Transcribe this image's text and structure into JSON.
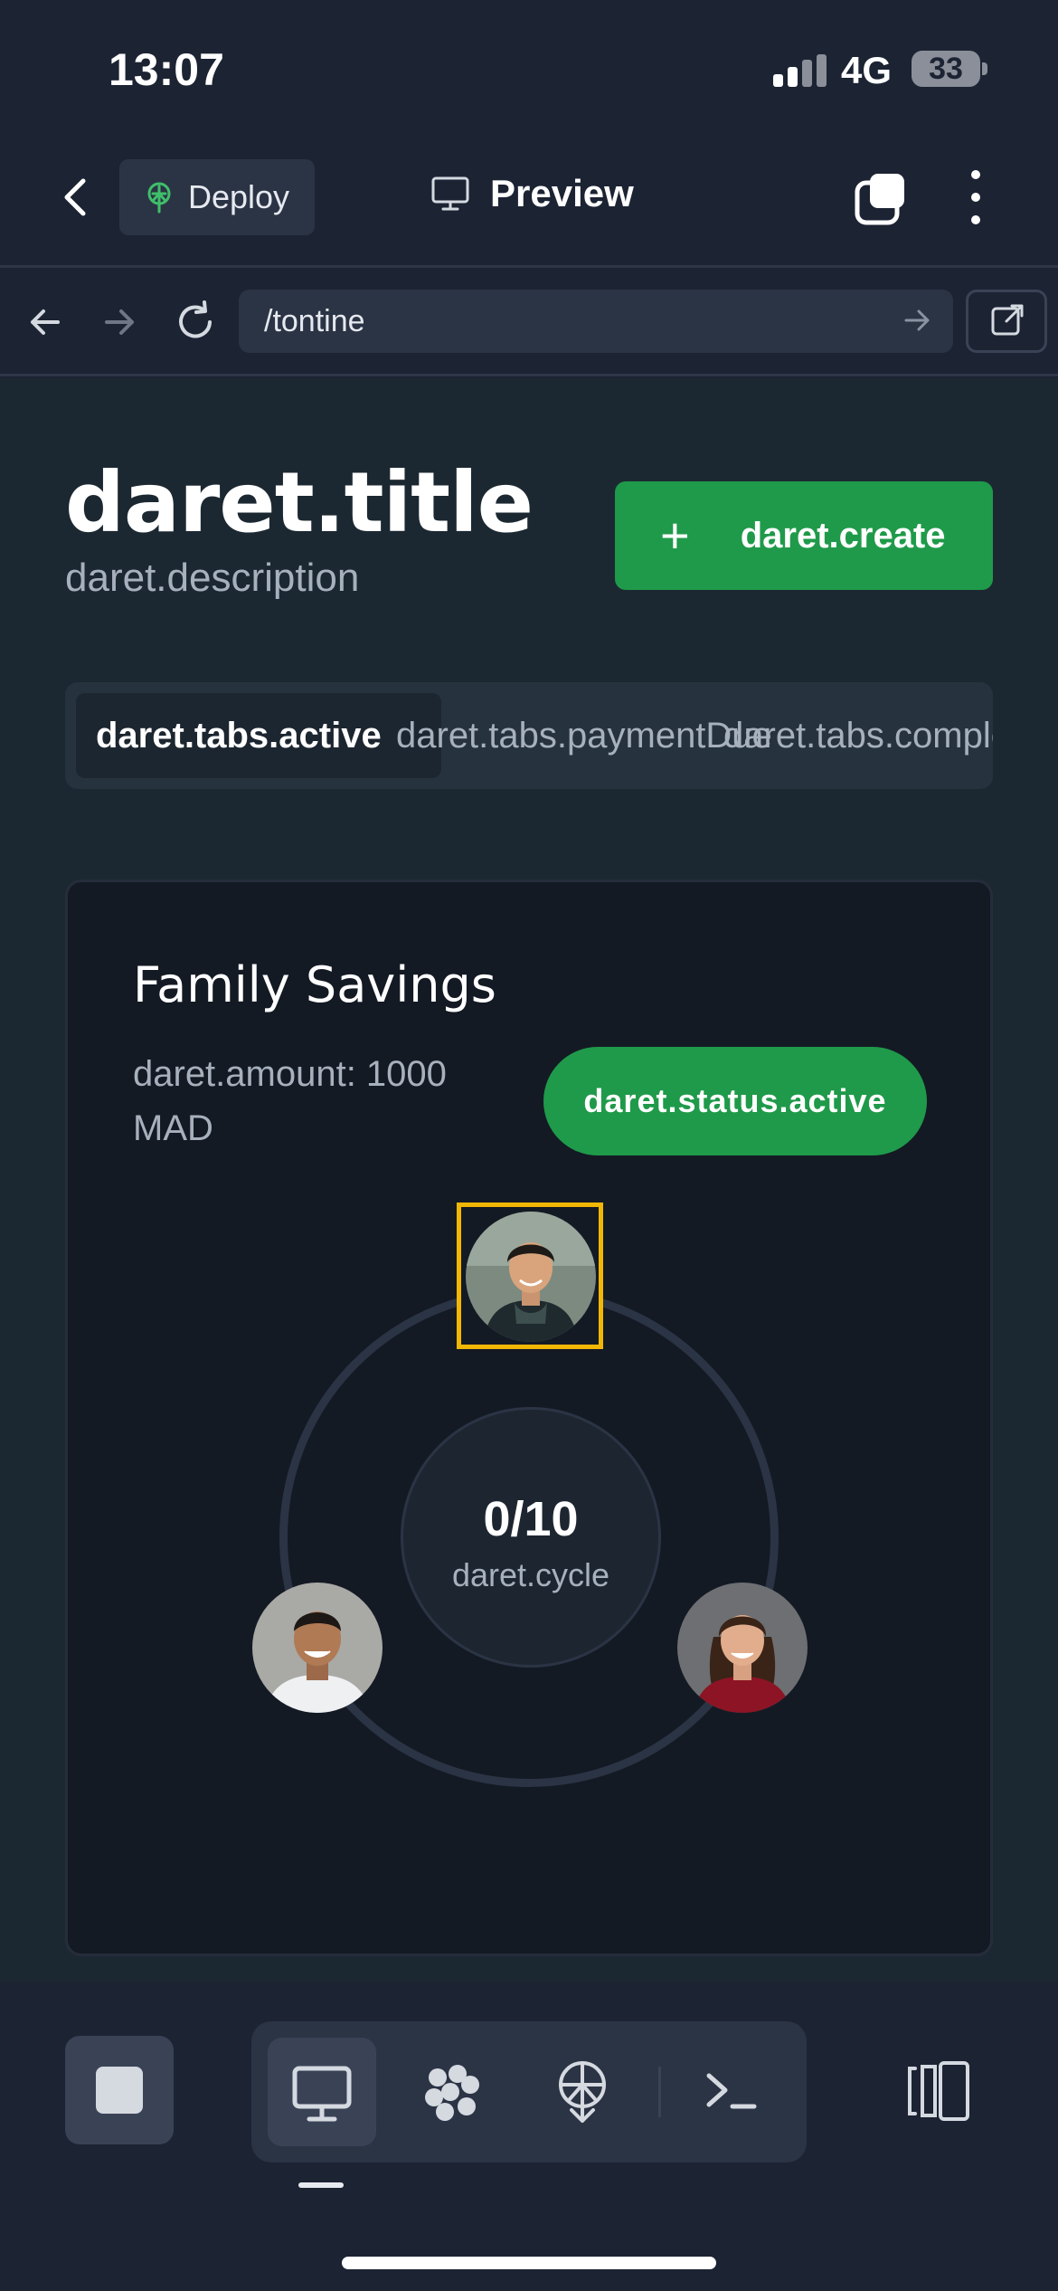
{
  "status_bar": {
    "time": "13:07",
    "network": "4G",
    "battery": "33"
  },
  "top_bar": {
    "deploy_label": "Deploy",
    "preview_label": "Preview"
  },
  "browser": {
    "url": "/tontine"
  },
  "page": {
    "title": "daret.title",
    "description": "daret.description",
    "create_label": "daret.create",
    "create_icon": "plus",
    "tabs": [
      {
        "label": "daret.tabs.active",
        "active": true
      },
      {
        "label": "daret.tabs.paymentDue",
        "active": false
      },
      {
        "label": "daret.tabs.completed",
        "active": false
      }
    ]
  },
  "card": {
    "title": "Family Savings",
    "amount": "daret.amount: 1000 MAD",
    "status": "daret.status.active",
    "cycle_count": "0/10",
    "cycle_label": "daret.cycle",
    "members": [
      {
        "position": "top",
        "current_turn": true,
        "highlight_color": "#f2b705"
      },
      {
        "position": "left",
        "current_turn": false
      },
      {
        "position": "right",
        "current_turn": false
      }
    ]
  },
  "colors": {
    "accent_green": "#1f9a4a",
    "highlight_yellow": "#f2b705",
    "background": "#1c2333"
  },
  "toolbar": {
    "items": [
      "stop-icon",
      "desktop-icon",
      "extensions-icon",
      "deploy-icon",
      "terminal-icon",
      "split-view-icon"
    ]
  }
}
